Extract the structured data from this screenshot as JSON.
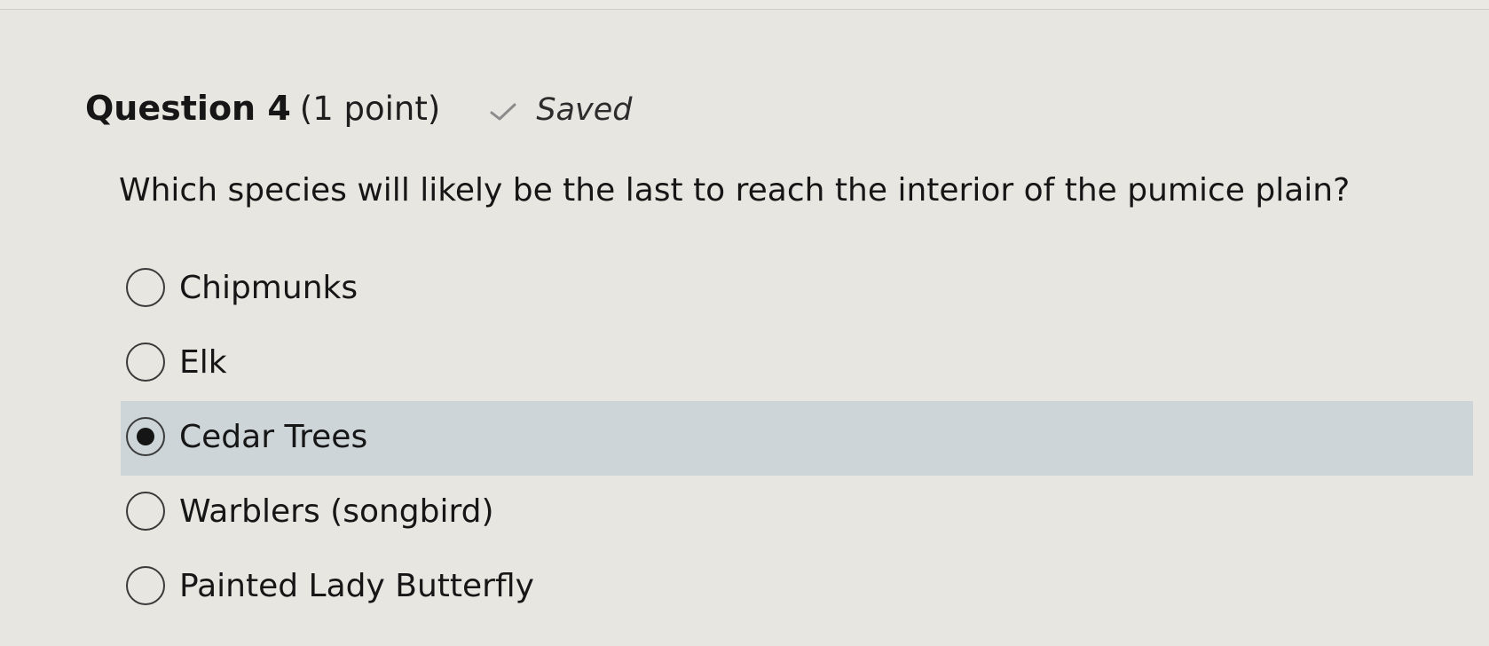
{
  "question": {
    "title": "Question 4",
    "points": "(1 point)",
    "status_icon": "check-icon",
    "status": "Saved",
    "prompt": "Which species will likely be the last to reach the interior of the pumice plain?"
  },
  "options": [
    {
      "label": "Chipmunks",
      "selected": false
    },
    {
      "label": "Elk",
      "selected": false
    },
    {
      "label": "Cedar Trees",
      "selected": true
    },
    {
      "label": "Warblers (songbird)",
      "selected": false
    },
    {
      "label": "Painted Lady Butterfly",
      "selected": false
    }
  ],
  "colors": {
    "background": "#e8e6e1",
    "selected_row": "#cdd5d9",
    "text": "#161616"
  }
}
